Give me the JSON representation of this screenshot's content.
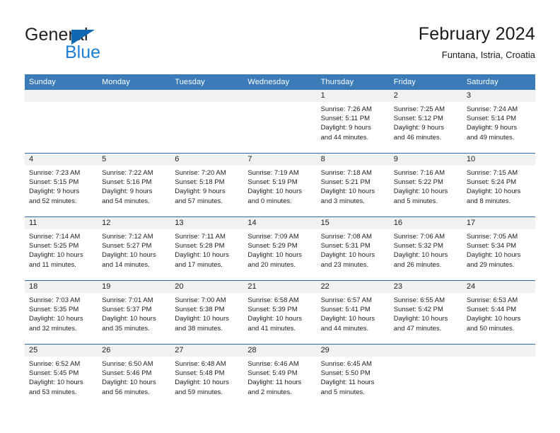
{
  "brand": {
    "name_primary": "General",
    "name_secondary": "Blue",
    "primary_color": "#231f20",
    "secondary_color": "#1c7fd4",
    "triangle_color": "#1068b3"
  },
  "header": {
    "title": "February 2024",
    "subtitle": "Funtana, Istria, Croatia"
  },
  "theme": {
    "header_bg": "#3b7cb8",
    "header_text": "#ffffff",
    "row_divider": "#2e6da4",
    "daynum_bg": "#f1f1f1"
  },
  "weekday_headers": [
    "Sunday",
    "Monday",
    "Tuesday",
    "Wednesday",
    "Thursday",
    "Friday",
    "Saturday"
  ],
  "weeks": [
    [
      {
        "day": "",
        "sunrise": "",
        "sunset": "",
        "daylight_line1": "",
        "daylight_line2": "",
        "blank": true
      },
      {
        "day": "",
        "sunrise": "",
        "sunset": "",
        "daylight_line1": "",
        "daylight_line2": "",
        "blank": true
      },
      {
        "day": "",
        "sunrise": "",
        "sunset": "",
        "daylight_line1": "",
        "daylight_line2": "",
        "blank": true
      },
      {
        "day": "",
        "sunrise": "",
        "sunset": "",
        "daylight_line1": "",
        "daylight_line2": "",
        "blank": true
      },
      {
        "day": "1",
        "sunrise": "Sunrise: 7:26 AM",
        "sunset": "Sunset: 5:11 PM",
        "daylight_line1": "Daylight: 9 hours",
        "daylight_line2": "and 44 minutes."
      },
      {
        "day": "2",
        "sunrise": "Sunrise: 7:25 AM",
        "sunset": "Sunset: 5:12 PM",
        "daylight_line1": "Daylight: 9 hours",
        "daylight_line2": "and 46 minutes."
      },
      {
        "day": "3",
        "sunrise": "Sunrise: 7:24 AM",
        "sunset": "Sunset: 5:14 PM",
        "daylight_line1": "Daylight: 9 hours",
        "daylight_line2": "and 49 minutes."
      }
    ],
    [
      {
        "day": "4",
        "sunrise": "Sunrise: 7:23 AM",
        "sunset": "Sunset: 5:15 PM",
        "daylight_line1": "Daylight: 9 hours",
        "daylight_line2": "and 52 minutes."
      },
      {
        "day": "5",
        "sunrise": "Sunrise: 7:22 AM",
        "sunset": "Sunset: 5:16 PM",
        "daylight_line1": "Daylight: 9 hours",
        "daylight_line2": "and 54 minutes."
      },
      {
        "day": "6",
        "sunrise": "Sunrise: 7:20 AM",
        "sunset": "Sunset: 5:18 PM",
        "daylight_line1": "Daylight: 9 hours",
        "daylight_line2": "and 57 minutes."
      },
      {
        "day": "7",
        "sunrise": "Sunrise: 7:19 AM",
        "sunset": "Sunset: 5:19 PM",
        "daylight_line1": "Daylight: 10 hours",
        "daylight_line2": "and 0 minutes."
      },
      {
        "day": "8",
        "sunrise": "Sunrise: 7:18 AM",
        "sunset": "Sunset: 5:21 PM",
        "daylight_line1": "Daylight: 10 hours",
        "daylight_line2": "and 3 minutes."
      },
      {
        "day": "9",
        "sunrise": "Sunrise: 7:16 AM",
        "sunset": "Sunset: 5:22 PM",
        "daylight_line1": "Daylight: 10 hours",
        "daylight_line2": "and 5 minutes."
      },
      {
        "day": "10",
        "sunrise": "Sunrise: 7:15 AM",
        "sunset": "Sunset: 5:24 PM",
        "daylight_line1": "Daylight: 10 hours",
        "daylight_line2": "and 8 minutes."
      }
    ],
    [
      {
        "day": "11",
        "sunrise": "Sunrise: 7:14 AM",
        "sunset": "Sunset: 5:25 PM",
        "daylight_line1": "Daylight: 10 hours",
        "daylight_line2": "and 11 minutes."
      },
      {
        "day": "12",
        "sunrise": "Sunrise: 7:12 AM",
        "sunset": "Sunset: 5:27 PM",
        "daylight_line1": "Daylight: 10 hours",
        "daylight_line2": "and 14 minutes."
      },
      {
        "day": "13",
        "sunrise": "Sunrise: 7:11 AM",
        "sunset": "Sunset: 5:28 PM",
        "daylight_line1": "Daylight: 10 hours",
        "daylight_line2": "and 17 minutes."
      },
      {
        "day": "14",
        "sunrise": "Sunrise: 7:09 AM",
        "sunset": "Sunset: 5:29 PM",
        "daylight_line1": "Daylight: 10 hours",
        "daylight_line2": "and 20 minutes."
      },
      {
        "day": "15",
        "sunrise": "Sunrise: 7:08 AM",
        "sunset": "Sunset: 5:31 PM",
        "daylight_line1": "Daylight: 10 hours",
        "daylight_line2": "and 23 minutes."
      },
      {
        "day": "16",
        "sunrise": "Sunrise: 7:06 AM",
        "sunset": "Sunset: 5:32 PM",
        "daylight_line1": "Daylight: 10 hours",
        "daylight_line2": "and 26 minutes."
      },
      {
        "day": "17",
        "sunrise": "Sunrise: 7:05 AM",
        "sunset": "Sunset: 5:34 PM",
        "daylight_line1": "Daylight: 10 hours",
        "daylight_line2": "and 29 minutes."
      }
    ],
    [
      {
        "day": "18",
        "sunrise": "Sunrise: 7:03 AM",
        "sunset": "Sunset: 5:35 PM",
        "daylight_line1": "Daylight: 10 hours",
        "daylight_line2": "and 32 minutes."
      },
      {
        "day": "19",
        "sunrise": "Sunrise: 7:01 AM",
        "sunset": "Sunset: 5:37 PM",
        "daylight_line1": "Daylight: 10 hours",
        "daylight_line2": "and 35 minutes."
      },
      {
        "day": "20",
        "sunrise": "Sunrise: 7:00 AM",
        "sunset": "Sunset: 5:38 PM",
        "daylight_line1": "Daylight: 10 hours",
        "daylight_line2": "and 38 minutes."
      },
      {
        "day": "21",
        "sunrise": "Sunrise: 6:58 AM",
        "sunset": "Sunset: 5:39 PM",
        "daylight_line1": "Daylight: 10 hours",
        "daylight_line2": "and 41 minutes."
      },
      {
        "day": "22",
        "sunrise": "Sunrise: 6:57 AM",
        "sunset": "Sunset: 5:41 PM",
        "daylight_line1": "Daylight: 10 hours",
        "daylight_line2": "and 44 minutes."
      },
      {
        "day": "23",
        "sunrise": "Sunrise: 6:55 AM",
        "sunset": "Sunset: 5:42 PM",
        "daylight_line1": "Daylight: 10 hours",
        "daylight_line2": "and 47 minutes."
      },
      {
        "day": "24",
        "sunrise": "Sunrise: 6:53 AM",
        "sunset": "Sunset: 5:44 PM",
        "daylight_line1": "Daylight: 10 hours",
        "daylight_line2": "and 50 minutes."
      }
    ],
    [
      {
        "day": "25",
        "sunrise": "Sunrise: 6:52 AM",
        "sunset": "Sunset: 5:45 PM",
        "daylight_line1": "Daylight: 10 hours",
        "daylight_line2": "and 53 minutes."
      },
      {
        "day": "26",
        "sunrise": "Sunrise: 6:50 AM",
        "sunset": "Sunset: 5:46 PM",
        "daylight_line1": "Daylight: 10 hours",
        "daylight_line2": "and 56 minutes."
      },
      {
        "day": "27",
        "sunrise": "Sunrise: 6:48 AM",
        "sunset": "Sunset: 5:48 PM",
        "daylight_line1": "Daylight: 10 hours",
        "daylight_line2": "and 59 minutes."
      },
      {
        "day": "28",
        "sunrise": "Sunrise: 6:46 AM",
        "sunset": "Sunset: 5:49 PM",
        "daylight_line1": "Daylight: 11 hours",
        "daylight_line2": "and 2 minutes."
      },
      {
        "day": "29",
        "sunrise": "Sunrise: 6:45 AM",
        "sunset": "Sunset: 5:50 PM",
        "daylight_line1": "Daylight: 11 hours",
        "daylight_line2": "and 5 minutes."
      },
      {
        "day": "",
        "sunrise": "",
        "sunset": "",
        "daylight_line1": "",
        "daylight_line2": "",
        "blank": true
      },
      {
        "day": "",
        "sunrise": "",
        "sunset": "",
        "daylight_line1": "",
        "daylight_line2": "",
        "blank": true
      }
    ]
  ]
}
